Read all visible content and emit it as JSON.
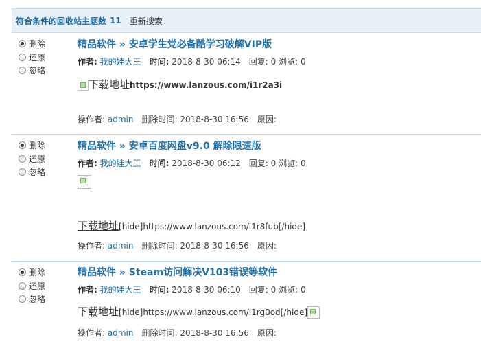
{
  "header": {
    "title": "符合条件的回收站主题数",
    "count": "11",
    "research": "重新搜索"
  },
  "radio_options": {
    "delete": "删除",
    "restore": "还原",
    "ignore": "忽略"
  },
  "labels": {
    "author": "作者:",
    "time": "时间:",
    "reply": "回复:",
    "views": "浏览:",
    "operator": "操作者:",
    "delete_time": "删除时间:",
    "reason": "原因:"
  },
  "items": [
    {
      "title": "精品软件 » 安卓学生党必备酷学习破解VIP版",
      "author": "我的娃大王",
      "time": "2018-8-30 06:14",
      "reply": "0",
      "views": "0",
      "download_text": "下载地址",
      "url": "https://www.lanzous.com/i1r2a3i",
      "operator": "admin",
      "delete_time": "2018-8-30 16:56"
    },
    {
      "title": "精品软件 » 安卓百度网盘v9.0 解除限速版",
      "author": "我的娃大王",
      "time": "2018-8-30 06:12",
      "reply": "0",
      "views": "0",
      "download_text": "下载地址",
      "url": "[hide]https://www.lanzous.com/i1r8fub[/hide]",
      "operator": "admin",
      "delete_time": "2018-8-30 16:56"
    },
    {
      "title": "精品软件 » Steam访问解决V103错误等软件",
      "author": "我的娃大王",
      "time": "2018-8-30 06:10",
      "reply": "0",
      "views": "0",
      "download_text": "下载地址",
      "url": "[hide]https://www.lanzous.com/i1rg0od[/hide]",
      "operator": "admin",
      "delete_time": "2018-8-30 16:56"
    }
  ]
}
